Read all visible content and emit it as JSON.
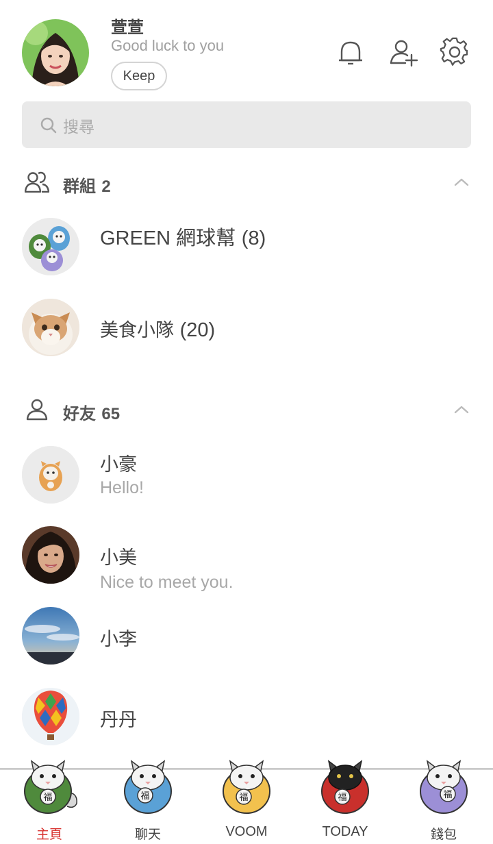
{
  "profile": {
    "name": "萱萱",
    "status": "Good luck to you",
    "keep_label": "Keep"
  },
  "header_icons": [
    "bell-icon",
    "add-friend-icon",
    "gear-icon"
  ],
  "search": {
    "placeholder": "搜尋"
  },
  "groups": {
    "label": "群組",
    "count": "2",
    "items": [
      {
        "name": "GREEN 網球幫",
        "count": "(8)"
      },
      {
        "name": "美食小隊",
        "count": "(20)"
      }
    ]
  },
  "friends": {
    "label": "好友",
    "count": "65",
    "items": [
      {
        "name": "小豪",
        "status": "Hello!"
      },
      {
        "name": "小美",
        "status": "Nice to meet you."
      },
      {
        "name": "小李",
        "status": ""
      },
      {
        "name": "丹丹",
        "status": ""
      }
    ]
  },
  "tabs": [
    {
      "label": "主頁",
      "color": "#4f8a3c",
      "active": true
    },
    {
      "label": "聊天",
      "color": "#5aa1d6",
      "active": false
    },
    {
      "label": "VOOM",
      "color": "#f2c14e",
      "active": false
    },
    {
      "label": "TODAY",
      "color": "#c9302c",
      "active": false
    },
    {
      "label": "錢包",
      "color": "#9c8fd6",
      "active": false
    }
  ],
  "colors": {
    "accent": "#d8322f",
    "search_bg": "#e9e9e9"
  }
}
